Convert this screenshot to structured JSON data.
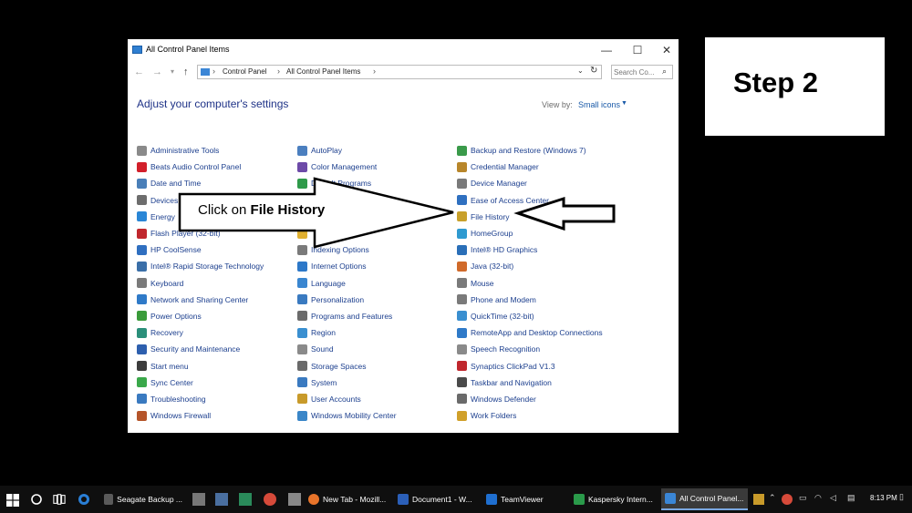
{
  "window": {
    "title": "All Control Panel Items",
    "controls": {
      "minimize": "—",
      "maximize": "☐",
      "close": "✕"
    }
  },
  "address": {
    "crumbs": [
      "Control Panel",
      "All Control Panel Items"
    ],
    "search_placeholder": "Search Co..."
  },
  "main": {
    "heading": "Adjust your computer's settings",
    "view_by_label": "View by:",
    "view_by_value": "Small icons"
  },
  "items": {
    "col1": [
      {
        "label": "Administrative Tools",
        "color": "#8a8a8a"
      },
      {
        "label": "Beats Audio Control Panel",
        "color": "#d21f2a"
      },
      {
        "label": "Date and Time",
        "color": "#4a7fb8"
      },
      {
        "label": "Devices",
        "color": "#6d6d6d"
      },
      {
        "label": "Energy",
        "color": "#2a86d6"
      },
      {
        "label": "Flash Player (32-bit)",
        "color": "#c0272d"
      },
      {
        "label": "HP CoolSense",
        "color": "#2f6fc0"
      },
      {
        "label": "Intel® Rapid Storage Technology",
        "color": "#3b6fa8"
      },
      {
        "label": "Keyboard",
        "color": "#7a7a7a"
      },
      {
        "label": "Network and Sharing Center",
        "color": "#2f7ac8"
      },
      {
        "label": "Power Options",
        "color": "#3a9b3a"
      },
      {
        "label": "Recovery",
        "color": "#2b8f7a"
      },
      {
        "label": "Security and Maintenance",
        "color": "#2d5fae"
      },
      {
        "label": "Start menu",
        "color": "#3c3c3c"
      },
      {
        "label": "Sync Center",
        "color": "#3aa84a"
      },
      {
        "label": "Troubleshooting",
        "color": "#3a7ac0"
      },
      {
        "label": "Windows Firewall",
        "color": "#b5552a"
      }
    ],
    "col2": [
      {
        "label": "AutoPlay",
        "color": "#4b7fbf"
      },
      {
        "label": "Color Management",
        "color": "#6d4aa8"
      },
      {
        "label": "Default Programs",
        "color": "#2f9a4a"
      },
      {
        "label": "",
        "color": "#ffffff"
      },
      {
        "label": "",
        "color": "#ffffff"
      },
      {
        "label": "",
        "color": "#e0b030"
      },
      {
        "label": "Indexing Options",
        "color": "#7a7a7a"
      },
      {
        "label": "Internet Options",
        "color": "#2d78c8"
      },
      {
        "label": "Language",
        "color": "#3a86d0"
      },
      {
        "label": "Personalization",
        "color": "#3a7ac0"
      },
      {
        "label": "Programs and Features",
        "color": "#6b6b6b"
      },
      {
        "label": "Region",
        "color": "#3a8fd0"
      },
      {
        "label": "Sound",
        "color": "#8a8a8a"
      },
      {
        "label": "Storage Spaces",
        "color": "#6a6a6a"
      },
      {
        "label": "System",
        "color": "#3a7ac0"
      },
      {
        "label": "User Accounts",
        "color": "#c89a2a"
      },
      {
        "label": "Windows Mobility Center",
        "color": "#3a86c8"
      }
    ],
    "col3": [
      {
        "label": "Backup and Restore (Windows 7)",
        "color": "#3a9a4a"
      },
      {
        "label": "Credential Manager",
        "color": "#b8862a"
      },
      {
        "label": "Device Manager",
        "color": "#7a7a7a"
      },
      {
        "label": "Ease of Access Center",
        "color": "#2f70c0"
      },
      {
        "label": "File History",
        "color": "#c8a02a"
      },
      {
        "label": "HomeGroup",
        "color": "#2f9ad0"
      },
      {
        "label": "Intel® HD Graphics",
        "color": "#2a6fb8"
      },
      {
        "label": "Java (32-bit)",
        "color": "#d06a2a"
      },
      {
        "label": "Mouse",
        "color": "#7a7a7a"
      },
      {
        "label": "Phone and Modem",
        "color": "#7a7a7a"
      },
      {
        "label": "QuickTime (32-bit)",
        "color": "#3a8fd0"
      },
      {
        "label": "RemoteApp and Desktop Connections",
        "color": "#2f7ac8"
      },
      {
        "label": "Speech Recognition",
        "color": "#8a8a8a"
      },
      {
        "label": "Synaptics ClickPad V1.3",
        "color": "#c0272d"
      },
      {
        "label": "Taskbar and Navigation",
        "color": "#4a4a4a"
      },
      {
        "label": "Windows Defender",
        "color": "#6a6a6a"
      },
      {
        "label": "Work Folders",
        "color": "#d0a02a"
      }
    ]
  },
  "annotation": {
    "prefix": "Click on ",
    "target": "File History",
    "step": "Step 2"
  },
  "taskbar": {
    "tasks": [
      {
        "label": "Seagate Backup ...",
        "color": "#5a5a5a"
      },
      {
        "label": "New Tab - Mozill...",
        "color": "#e8742a"
      },
      {
        "label": "Document1 - W...",
        "color": "#2b5fb8"
      },
      {
        "label": "TeamViewer",
        "color": "#1f6fd0"
      },
      {
        "label": "Kaspersky Intern...",
        "color": "#2a9a4a"
      },
      {
        "label": "All Control Panel...",
        "color": "#3a86d6"
      }
    ],
    "clock": "8:13 PM"
  }
}
